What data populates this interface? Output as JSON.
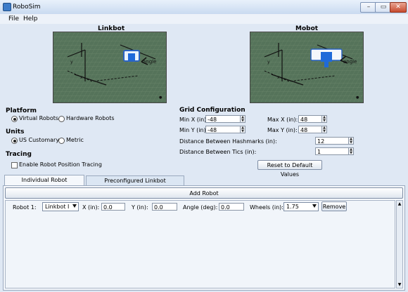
{
  "window": {
    "title": "RoboSim",
    "minimize": "–",
    "maximize": "▭",
    "close": "✕"
  },
  "menu": {
    "file": "File",
    "help": "Help"
  },
  "previews": {
    "linkbot": {
      "title": "Linkbot",
      "x_label": "x",
      "y_label": "y",
      "angle_label": "angle"
    },
    "mobot": {
      "title": "Mobot",
      "x_label": "x",
      "y_label": "y",
      "angle_label": "angle"
    }
  },
  "platform": {
    "title": "Platform",
    "options": [
      "Virtual Robots",
      "Hardware Robots"
    ],
    "selected": 0
  },
  "units": {
    "title": "Units",
    "options": [
      "US Customary",
      "Metric"
    ],
    "selected": 0
  },
  "tracing": {
    "title": "Tracing",
    "checkbox_label": "Enable Robot Position Tracing",
    "checked": false
  },
  "grid": {
    "title": "Grid Configuration",
    "min_x_label": "Min X (in):",
    "min_x": "-48",
    "max_x_label": "Max X (in):",
    "max_x": "48",
    "min_y_label": "Min Y (in):",
    "min_y": "-48",
    "max_y_label": "Max Y (in):",
    "max_y": "48",
    "hashmarks_label": "Distance Between Hashmarks (in):",
    "hashmarks": "12",
    "tics_label": "Distance Between Tics (in):",
    "tics": "1",
    "reset_label": "Reset to Default Values"
  },
  "tabs": [
    "Individual Robot Configuration",
    "Preconfigured Linkbot Configurations"
  ],
  "robot_panel": {
    "add_robot": "Add Robot",
    "robot_label": "Robot 1:",
    "robot_type": "Linkbot I",
    "x_label": "X (in):",
    "x": "0.0",
    "y_label": "Y (in):",
    "y": "0.0",
    "angle_label": "Angle (deg):",
    "angle": "0.0",
    "wheels_label": "Wheels (in):",
    "wheels": "1.75",
    "remove_label": "Remove"
  }
}
